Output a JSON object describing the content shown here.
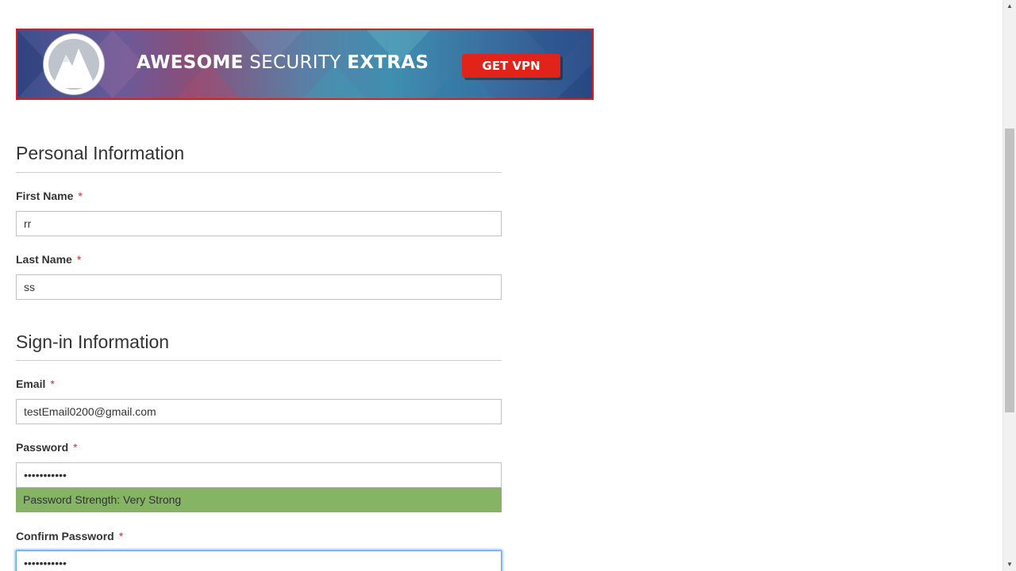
{
  "banner": {
    "text_bold_1": "AWESOME",
    "text_light": " SECURITY ",
    "text_bold_2": "EXTRAS",
    "cta_label": "GET VPN",
    "colors": {
      "border": "#d81e1e",
      "cta": "#e2231a"
    }
  },
  "personal": {
    "title": "Personal Information",
    "first_name": {
      "label": "First Name",
      "required_mark": "*",
      "value": "rr"
    },
    "last_name": {
      "label": "Last Name",
      "required_mark": "*",
      "value": "ss"
    }
  },
  "signin": {
    "title": "Sign-in Information",
    "email": {
      "label": "Email",
      "required_mark": "*",
      "value": "testEmail0200@gmail.com"
    },
    "password": {
      "label": "Password",
      "required_mark": "*",
      "value": "•••••••••••"
    },
    "strength": {
      "text": "Password Strength: Very Strong",
      "color": "#84b464"
    },
    "confirm_password": {
      "label": "Confirm Password",
      "required_mark": "*",
      "value": "•••••••••••"
    }
  },
  "icons": {
    "banner_logo": "mountain-logo-icon",
    "scroll_up": "triangle-up-icon",
    "scroll_down": "triangle-down-icon"
  },
  "colors": {
    "required": "#e02b27",
    "focus_border": "#68a8e0",
    "input_border": "#c2c2c2",
    "text": "#333333"
  }
}
